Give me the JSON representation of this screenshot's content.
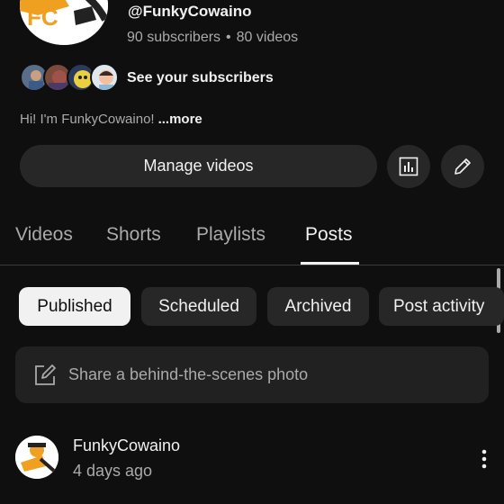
{
  "channel": {
    "handle": "@FunkyCowaino",
    "subscribers": "90 subscribers",
    "separator": "•",
    "videos": "80 videos",
    "see_subscribers": "See your subscribers",
    "description": "Hi! I'm FunkyCowaino!",
    "more_label": "...more",
    "avatar_text": "FC"
  },
  "actions": {
    "manage_videos": "Manage videos",
    "analytics_icon": "analytics-icon",
    "edit_icon": "pencil-icon"
  },
  "tabs": [
    {
      "label": "Videos",
      "active": false
    },
    {
      "label": "Shorts",
      "active": false
    },
    {
      "label": "Playlists",
      "active": false
    },
    {
      "label": "Posts",
      "active": true
    }
  ],
  "chips": [
    {
      "label": "Published",
      "selected": true
    },
    {
      "label": "Scheduled",
      "selected": false
    },
    {
      "label": "Archived",
      "selected": false
    },
    {
      "label": "Post activity",
      "selected": false
    }
  ],
  "composer": {
    "placeholder": "Share a behind-the-scenes photo"
  },
  "post": {
    "author": "FunkyCowaino",
    "time": "4 days ago"
  },
  "colors": {
    "background": "#0f0f0f",
    "surface": "#272727",
    "text_primary": "#f1f1f1",
    "text_secondary": "#aaaaaa",
    "brand_orange": "#f0a020"
  }
}
